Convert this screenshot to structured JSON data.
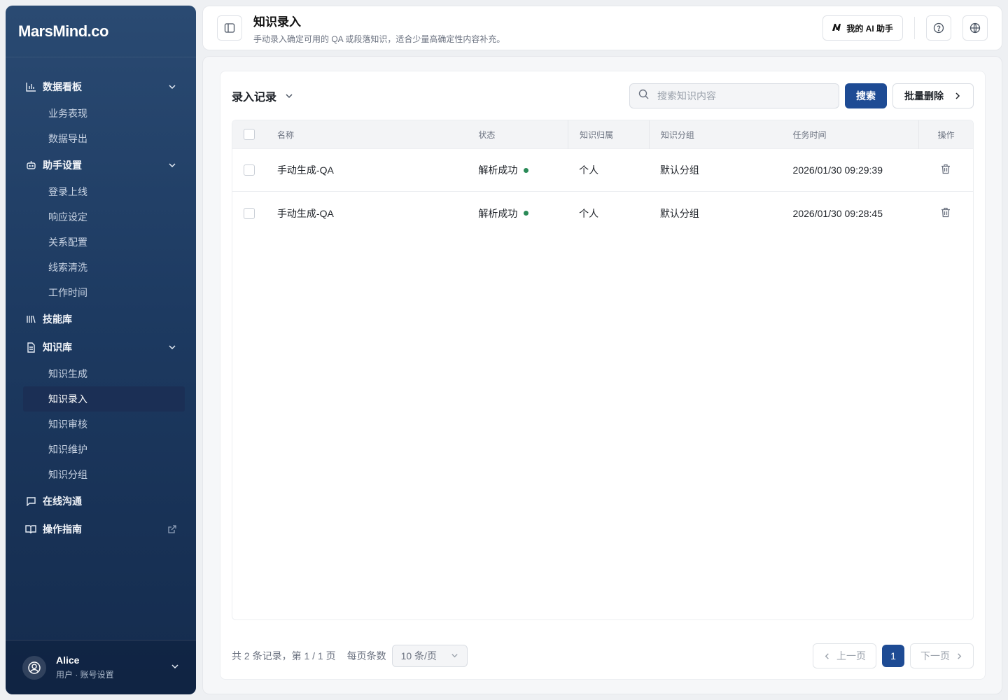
{
  "brand": {
    "name": "MarsMind.co"
  },
  "sidebar": {
    "groups": [
      {
        "label": "数据看板",
        "icon": "bar-chart-icon",
        "items": [
          "业务表现",
          "数据导出"
        ]
      },
      {
        "label": "助手设置",
        "icon": "robot-icon",
        "items": [
          "登录上线",
          "响应设定",
          "关系配置",
          "线索清洗",
          "工作时间"
        ]
      },
      {
        "label": "技能库",
        "icon": "library-icon",
        "items": []
      },
      {
        "label": "知识库",
        "icon": "document-icon",
        "items": [
          "知识生成",
          "知识录入",
          "知识审核",
          "知识维护",
          "知识分组"
        ]
      },
      {
        "label": "在线沟通",
        "icon": "chat-icon",
        "items": []
      },
      {
        "label": "操作指南",
        "icon": "book-icon",
        "items": []
      }
    ],
    "active_item": "知识录入",
    "user": {
      "name": "Alice",
      "sub": "用户 · 账号设置"
    }
  },
  "header": {
    "title": "知识录入",
    "description": "手动录入确定可用的 QA 或段落知识，适合少量高确定性内容补充。",
    "ai_button": "我的 AI 助手"
  },
  "main": {
    "record_title": "录入记录",
    "search": {
      "placeholder": "搜索知识内容",
      "button": "搜索"
    },
    "batch_delete": "批量删除",
    "table": {
      "columns": [
        "名称",
        "状态",
        "知识归属",
        "知识分组",
        "任务时间",
        "操作"
      ],
      "rows": [
        {
          "name": "手动生成-QA",
          "status": "解析成功",
          "owner": "个人",
          "group": "默认分组",
          "time": "2026/01/30 09:29:39"
        },
        {
          "name": "手动生成-QA",
          "status": "解析成功",
          "owner": "个人",
          "group": "默认分组",
          "time": "2026/01/30 09:28:45"
        }
      ]
    },
    "pagination": {
      "summary": "共 2 条记录，第 1 / 1 页",
      "page_size_label": "每页条数",
      "page_size_value": "10 条/页",
      "prev": "上一页",
      "current": "1",
      "next": "下一页"
    }
  },
  "colors": {
    "primary": "#1e4b94",
    "status_success": "#2a8a57",
    "sidebar_top": "#2a4a72",
    "sidebar_bottom": "#142b4d"
  }
}
